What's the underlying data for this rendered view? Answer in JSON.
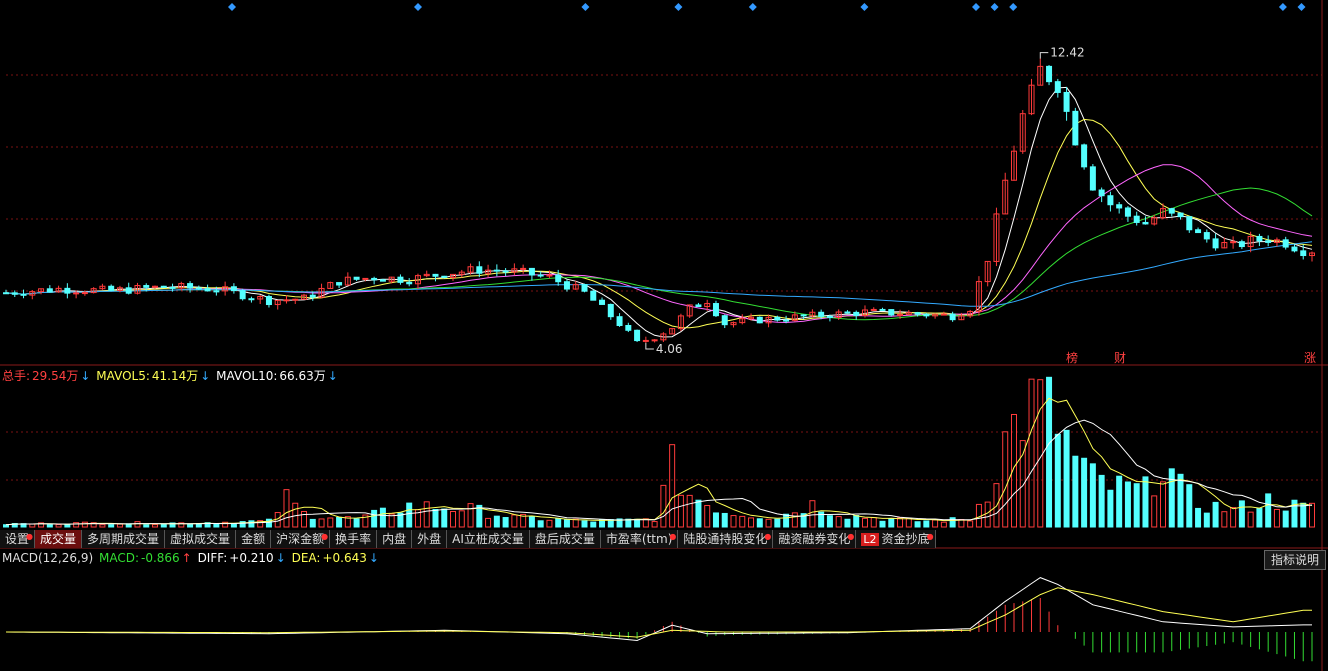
{
  "colors": {
    "up": "#ff3b3b",
    "down": "#54ffff",
    "ma_white": "#ffffff",
    "ma_yellow": "#ffff55",
    "ma_magenta": "#ff66ff",
    "ma_green": "#33dd33",
    "ma_blue": "#33aaff",
    "grid": "#7a1212",
    "signal": "#3399ff"
  },
  "main_chart": {
    "high_label": "12.42",
    "low_label": "4.06",
    "markers": [
      {
        "text": "榜"
      },
      {
        "text": "财"
      },
      {
        "text": "涨"
      }
    ]
  },
  "volume_legend": {
    "total_label": "总手:",
    "total_value": "29.54万",
    "total_arrow": "↓",
    "mavol5_label": "MAVOL5:",
    "mavol5_value": "41.14万",
    "mavol5_arrow": "↓",
    "mavol10_label": "MAVOL10:",
    "mavol10_value": "66.63万",
    "mavol10_arrow": "↓"
  },
  "tabs": [
    {
      "label": "设置",
      "dot": true
    },
    {
      "label": "成交量",
      "active": true
    },
    {
      "label": "多周期成交量"
    },
    {
      "label": "虚拟成交量"
    },
    {
      "label": "金额"
    },
    {
      "label": "沪深金额",
      "dot": true
    },
    {
      "label": "换手率"
    },
    {
      "label": "内盘"
    },
    {
      "label": "外盘"
    },
    {
      "label": "AI立桩成交量"
    },
    {
      "label": "盘后成交量"
    },
    {
      "label": "市盈率(ttm)",
      "dot": true
    },
    {
      "label": "陆股通持股变化",
      "dot": true
    },
    {
      "label": "融资融券变化",
      "dot": true
    },
    {
      "label": "资金抄底",
      "badge": "L2",
      "dot": true
    }
  ],
  "macd_legend": {
    "name": "MACD(12,26,9)",
    "macd_label": "MACD:",
    "macd_value": "-0.866",
    "macd_arrow": "↑",
    "diff_label": "DIFF:",
    "diff_value": "+0.210",
    "diff_arrow": "↓",
    "dea_label": "DEA:",
    "dea_value": "+0.643",
    "dea_arrow": "↓"
  },
  "help_button": "指标说明",
  "chart_data": {
    "type": "candlestick",
    "ylim": [
      3.8,
      13.0
    ],
    "close_points": [
      [
        0,
        5.6
      ],
      [
        6,
        5.7
      ],
      [
        12,
        5.65
      ],
      [
        18,
        5.75
      ],
      [
        24,
        5.7
      ],
      [
        30,
        5.4
      ],
      [
        34,
        5.45
      ],
      [
        38,
        5.9
      ],
      [
        42,
        6.0
      ],
      [
        46,
        5.95
      ],
      [
        50,
        6.1
      ],
      [
        54,
        6.2
      ],
      [
        58,
        6.15
      ],
      [
        62,
        6.0
      ],
      [
        66,
        5.6
      ],
      [
        68,
        5.2
      ],
      [
        70,
        4.8
      ],
      [
        72,
        4.3
      ],
      [
        74,
        4.45
      ],
      [
        76,
        4.7
      ],
      [
        78,
        5.2
      ],
      [
        80,
        5.4
      ],
      [
        82,
        4.8
      ],
      [
        86,
        4.9
      ],
      [
        92,
        5.0
      ],
      [
        98,
        5.1
      ],
      [
        104,
        5.05
      ],
      [
        108,
        5.0
      ],
      [
        110,
        5.2
      ],
      [
        112,
        6.5
      ],
      [
        114,
        8.5
      ],
      [
        116,
        10.2
      ],
      [
        118,
        11.4
      ],
      [
        120,
        11.0
      ],
      [
        122,
        9.6
      ],
      [
        124,
        8.4
      ],
      [
        126,
        7.9
      ],
      [
        128,
        7.6
      ],
      [
        130,
        7.4
      ],
      [
        132,
        7.7
      ],
      [
        134,
        7.5
      ],
      [
        136,
        7.1
      ],
      [
        138,
        6.9
      ],
      [
        140,
        6.8
      ],
      [
        142,
        6.95
      ],
      [
        144,
        7.0
      ],
      [
        146,
        6.9
      ],
      [
        148,
        6.7
      ]
    ],
    "volume_max": 150,
    "volume_points": [
      [
        0,
        3
      ],
      [
        10,
        4
      ],
      [
        20,
        4
      ],
      [
        30,
        6
      ],
      [
        32,
        30
      ],
      [
        34,
        14
      ],
      [
        40,
        8
      ],
      [
        46,
        22
      ],
      [
        52,
        20
      ],
      [
        58,
        10
      ],
      [
        66,
        6
      ],
      [
        72,
        7
      ],
      [
        74,
        9
      ],
      [
        76,
        62
      ],
      [
        78,
        34
      ],
      [
        82,
        16
      ],
      [
        88,
        10
      ],
      [
        92,
        24
      ],
      [
        96,
        12
      ],
      [
        104,
        6
      ],
      [
        110,
        8
      ],
      [
        112,
        40
      ],
      [
        114,
        90
      ],
      [
        116,
        120
      ],
      [
        118,
        132
      ],
      [
        120,
        110
      ],
      [
        122,
        70
      ],
      [
        124,
        50
      ],
      [
        126,
        42
      ],
      [
        130,
        38
      ],
      [
        132,
        70
      ],
      [
        134,
        40
      ],
      [
        136,
        24
      ],
      [
        140,
        18
      ],
      [
        144,
        28
      ],
      [
        148,
        20
      ]
    ],
    "macd": {
      "name": "MACD(12,26,9)",
      "diff_points": [
        [
          0,
          0.0
        ],
        [
          30,
          -0.05
        ],
        [
          50,
          0.05
        ],
        [
          64,
          -0.05
        ],
        [
          72,
          -0.25
        ],
        [
          76,
          0.2
        ],
        [
          80,
          -0.05
        ],
        [
          96,
          -0.02
        ],
        [
          110,
          0.1
        ],
        [
          114,
          0.9
        ],
        [
          118,
          1.6
        ],
        [
          120,
          1.4
        ],
        [
          124,
          0.8
        ],
        [
          132,
          0.3
        ],
        [
          140,
          0.15
        ],
        [
          148,
          0.21
        ]
      ],
      "dea_points": [
        [
          0,
          0.0
        ],
        [
          30,
          -0.02
        ],
        [
          50,
          0.03
        ],
        [
          64,
          -0.02
        ],
        [
          72,
          -0.15
        ],
        [
          76,
          0.05
        ],
        [
          82,
          0.0
        ],
        [
          96,
          0.0
        ],
        [
          110,
          0.05
        ],
        [
          114,
          0.5
        ],
        [
          118,
          1.1
        ],
        [
          120,
          1.3
        ],
        [
          124,
          1.1
        ],
        [
          132,
          0.6
        ],
        [
          140,
          0.3
        ],
        [
          148,
          0.64
        ]
      ]
    }
  }
}
